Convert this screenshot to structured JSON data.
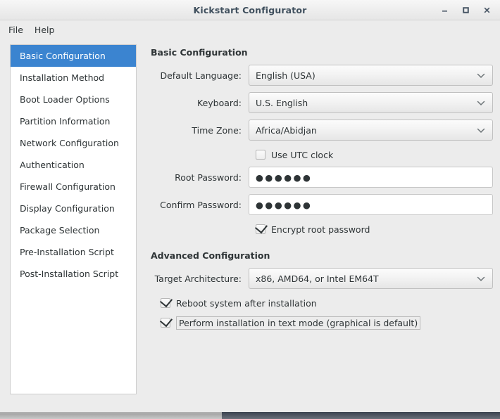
{
  "window": {
    "title": "Kickstart Configurator",
    "controls": [
      {
        "name": "minimize",
        "glyph": "minimize-icon"
      },
      {
        "name": "maximize",
        "glyph": "maximize-icon"
      },
      {
        "name": "close",
        "glyph": "close-icon"
      }
    ]
  },
  "menubar": {
    "items": [
      {
        "label": "File"
      },
      {
        "label": "Help"
      }
    ]
  },
  "sidebar": {
    "items": [
      {
        "label": "Basic Configuration",
        "selected": true
      },
      {
        "label": "Installation Method",
        "selected": false
      },
      {
        "label": "Boot Loader Options",
        "selected": false
      },
      {
        "label": "Partition Information",
        "selected": false
      },
      {
        "label": "Network Configuration",
        "selected": false
      },
      {
        "label": "Authentication",
        "selected": false
      },
      {
        "label": "Firewall Configuration",
        "selected": false
      },
      {
        "label": "Display Configuration",
        "selected": false
      },
      {
        "label": "Package Selection",
        "selected": false
      },
      {
        "label": "Pre-Installation Script",
        "selected": false
      },
      {
        "label": "Post-Installation Script",
        "selected": false
      }
    ]
  },
  "basic": {
    "heading": "Basic Configuration",
    "default_language": {
      "label": "Default Language:",
      "value": "English (USA)"
    },
    "keyboard": {
      "label": "Keyboard:",
      "value": "U.S. English"
    },
    "time_zone": {
      "label": "Time Zone:",
      "value": "Africa/Abidjan"
    },
    "use_utc": {
      "label": "Use UTC clock",
      "checked": false
    },
    "root_password": {
      "label": "Root Password:",
      "value": "●●●●●●"
    },
    "confirm_password": {
      "label": "Confirm Password:",
      "value": "●●●●●●"
    },
    "encrypt_root_password": {
      "label": "Encrypt root password",
      "checked": true
    }
  },
  "advanced": {
    "heading": "Advanced Configuration",
    "target_architecture": {
      "label": "Target Architecture:",
      "value": "x86, AMD64, or Intel EM64T"
    },
    "reboot_after_install": {
      "label": "Reboot system after installation",
      "checked": true
    },
    "text_mode": {
      "label": "Perform installation in text mode (graphical is default)",
      "checked": true,
      "focused": true
    }
  },
  "colors": {
    "selection_blue": "#3b84d0",
    "window_bg": "#ececec",
    "text": "#2e3436",
    "title_text": "#40505e",
    "desktop": "#4c535f"
  }
}
